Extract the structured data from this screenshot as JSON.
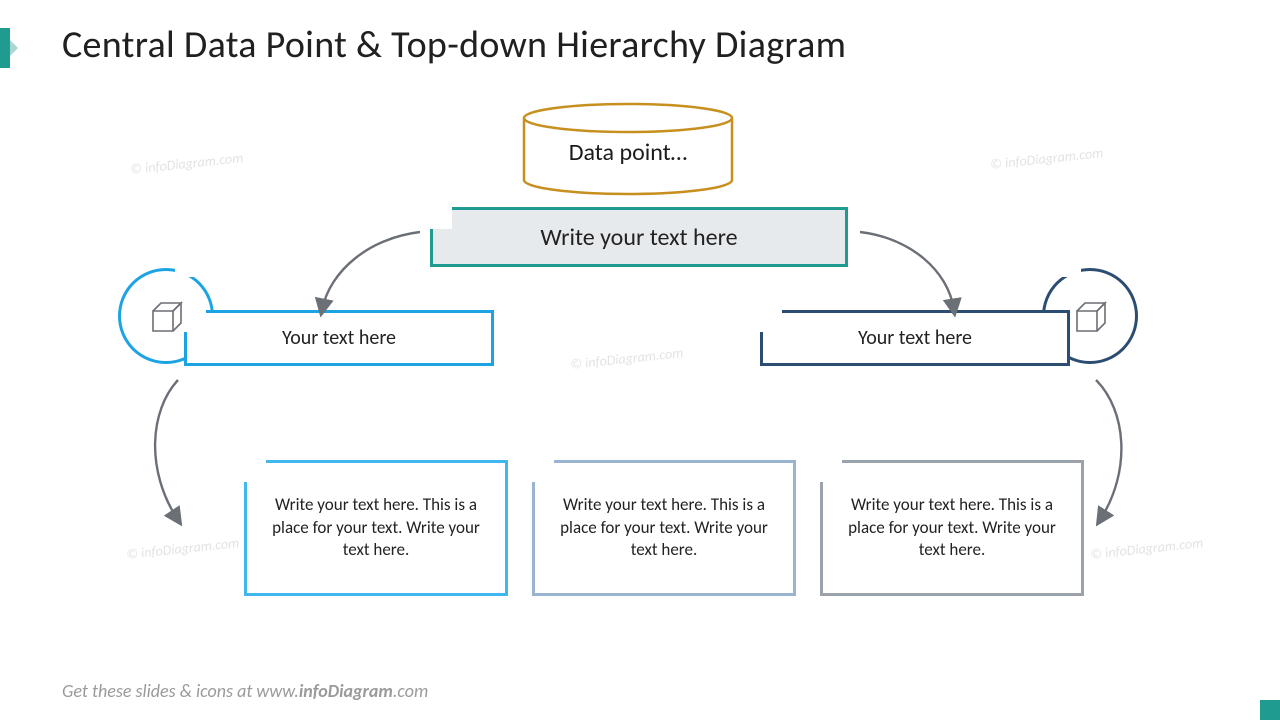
{
  "title": "Central Data Point & Top-down Hierarchy Diagram",
  "footer_prefix": "Get these slides & icons at www.",
  "footer_brand": "infoDiagram",
  "footer_suffix": ".com",
  "watermark": "© infoDiagram.com",
  "cylinder_label": "Data point…",
  "main_box": "Write your text here",
  "level2_left": "Your text here",
  "level2_right": "Your text here",
  "level3_a": "Write your text here. This is a place for your text. Write your text here.",
  "level3_b": "Write your text here. This is a place for your text. Write your text here.",
  "level3_c": "Write your text here. This is a place for your text. Write your text here.",
  "colors": {
    "accent": "#1f9c8f",
    "cylinder": "#c78f1e",
    "left": "#1ca3e3",
    "right": "#2b4d72",
    "b1": "#41b7ef",
    "b2": "#99b5cf",
    "b3": "#9aa2ab",
    "arrow": "#6b6f76"
  }
}
